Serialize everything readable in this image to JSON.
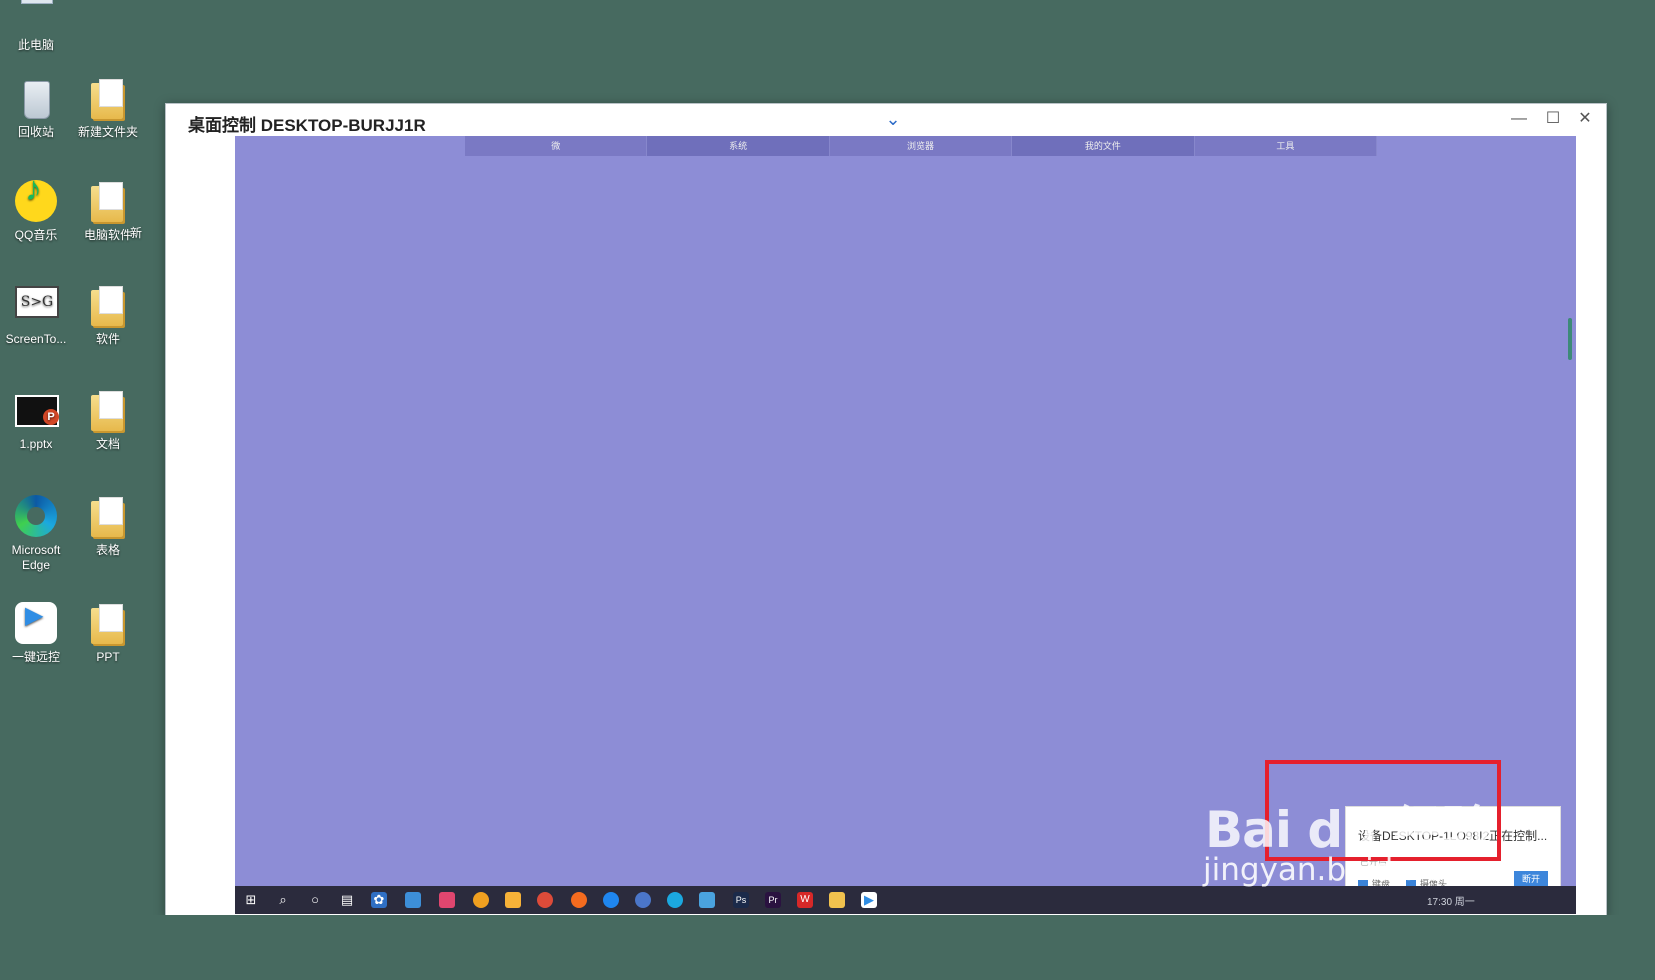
{
  "desktop": {
    "icons": [
      {
        "label": "此电脑",
        "x": 0,
        "y": 0
      },
      {
        "label": "回收站"
      },
      {
        "label": "新建文件夹"
      },
      {
        "label": "QQ音乐"
      },
      {
        "label": "电脑软件"
      },
      {
        "label": "新"
      },
      {
        "label": "ScreenTo..."
      },
      {
        "label": "软件"
      },
      {
        "label": "1.pptx"
      },
      {
        "label": "文档"
      },
      {
        "label": "Microsoft Edge"
      },
      {
        "label": "表格"
      },
      {
        "label": "一键远控"
      },
      {
        "label": "PPT"
      }
    ]
  },
  "window": {
    "title": "桌面控制 DESKTOP-BURJJ1R",
    "dropdown_icon": "chevron-down-icon",
    "minimize": "—",
    "maximize": "☐",
    "close": "✕"
  },
  "remote": {
    "nav": [
      "微",
      "系统",
      "浏览器",
      "我的文件",
      "工具"
    ],
    "notification": {
      "message": "设备DESKTOP-1LO98I2正在控制...",
      "subtext": "已开启",
      "checkbox1": "键盘",
      "checkbox2": "摄像头",
      "button": "断开"
    },
    "tray": {
      "time": "17:30 周一"
    }
  },
  "watermark": {
    "text": "Bai du 经验",
    "url": "jingyan.baidu.com"
  },
  "colors": {
    "desktop": "#476a60",
    "remote_bg": "#8d8dd6",
    "highlight": "#e5202d",
    "taskbar": "#2b2b3d"
  }
}
